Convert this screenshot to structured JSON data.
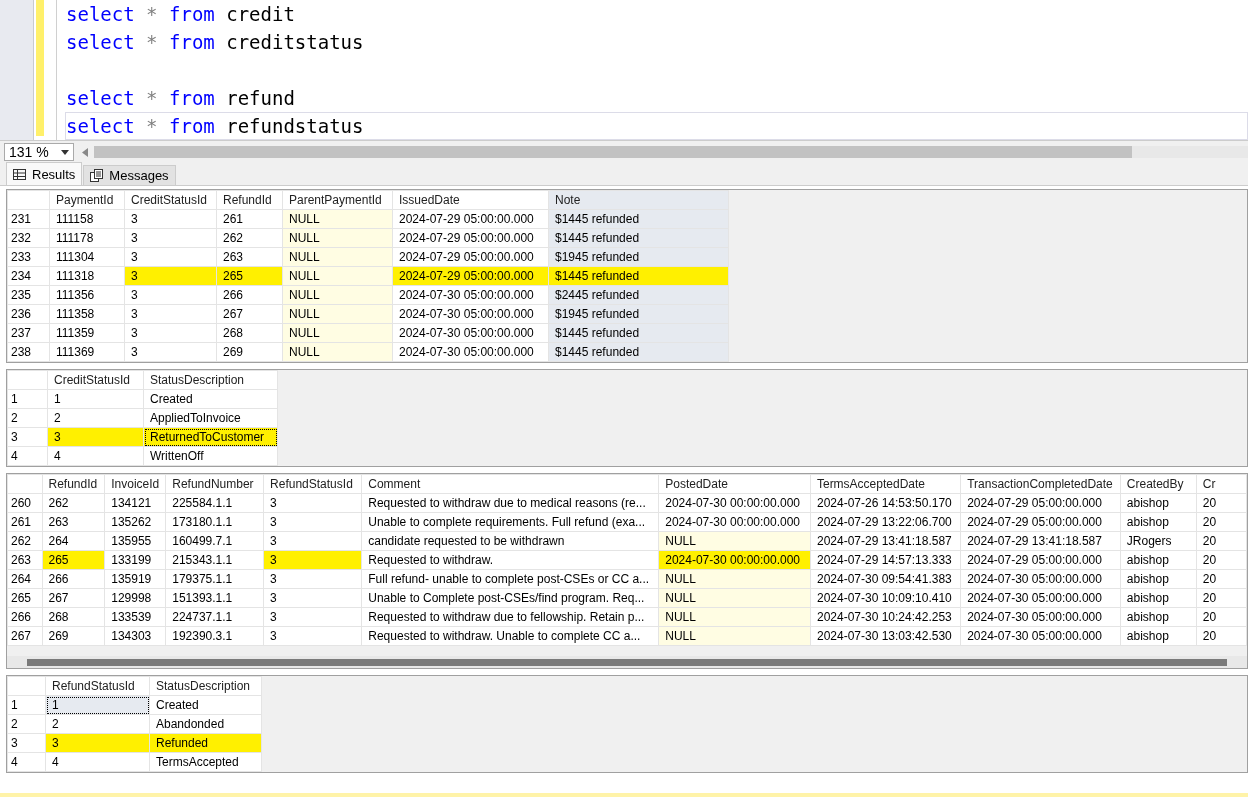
{
  "editor": {
    "lines": [
      {
        "current": false,
        "tokens": [
          {
            "kind": "keyword",
            "text": "select"
          },
          {
            "kind": "operator",
            "text": "*"
          },
          {
            "kind": "keyword",
            "text": "from"
          },
          {
            "kind": "identifier",
            "text": "credit"
          }
        ]
      },
      {
        "current": false,
        "tokens": [
          {
            "kind": "keyword",
            "text": "select"
          },
          {
            "kind": "operator",
            "text": "*"
          },
          {
            "kind": "keyword",
            "text": "from"
          },
          {
            "kind": "identifier",
            "text": "creditstatus"
          }
        ]
      },
      {
        "current": false
      },
      {
        "current": false,
        "tokens": [
          {
            "kind": "keyword",
            "text": "select"
          },
          {
            "kind": "operator",
            "text": "*"
          },
          {
            "kind": "keyword",
            "text": "from"
          },
          {
            "kind": "identifier",
            "text": "refund"
          }
        ]
      },
      {
        "current": true,
        "tokens": [
          {
            "kind": "keyword",
            "text": "select"
          },
          {
            "kind": "operator",
            "text": "*"
          },
          {
            "kind": "keyword",
            "text": "from"
          },
          {
            "kind": "identifier",
            "text": "refundstatus"
          }
        ]
      }
    ]
  },
  "zoom": {
    "value": "131 %"
  },
  "tabs": [
    {
      "label": "Results",
      "selected": true
    },
    {
      "label": "Messages",
      "selected": false
    }
  ],
  "grids": [
    {
      "columns": [
        {
          "label": "PaymentId",
          "selected": false
        },
        {
          "label": "CreditStatusId",
          "selected": false
        },
        {
          "label": "RefundId",
          "selected": false
        },
        {
          "label": "ParentPaymentId",
          "selected": false
        },
        {
          "label": "IssuedDate",
          "selected": false
        },
        {
          "label": "Note",
          "selected": true
        }
      ],
      "rows": [
        {
          "num": "231",
          "cells": [
            {
              "text": "111158",
              "null": false,
              "marked": false,
              "focused": false
            },
            {
              "text": "3",
              "null": false,
              "marked": false,
              "focused": false
            },
            {
              "text": "261",
              "null": false,
              "marked": false,
              "focused": false
            },
            {
              "text": "NULL",
              "null": true,
              "marked": false,
              "focused": false
            },
            {
              "text": "2024-07-29 05:00:00.000",
              "null": false,
              "marked": false,
              "focused": false
            },
            {
              "text": "$1445 refunded",
              "null": false,
              "marked": false,
              "focused": false
            }
          ]
        },
        {
          "num": "232",
          "cells": [
            {
              "text": "111178",
              "null": false,
              "marked": false,
              "focused": false
            },
            {
              "text": "3",
              "null": false,
              "marked": false,
              "focused": false
            },
            {
              "text": "262",
              "null": false,
              "marked": false,
              "focused": false
            },
            {
              "text": "NULL",
              "null": true,
              "marked": false,
              "focused": false
            },
            {
              "text": "2024-07-29 05:00:00.000",
              "null": false,
              "marked": false,
              "focused": false
            },
            {
              "text": "$1445 refunded",
              "null": false,
              "marked": false,
              "focused": false
            }
          ]
        },
        {
          "num": "233",
          "cells": [
            {
              "text": "111304",
              "null": false,
              "marked": false,
              "focused": false
            },
            {
              "text": "3",
              "null": false,
              "marked": false,
              "focused": false
            },
            {
              "text": "263",
              "null": false,
              "marked": false,
              "focused": false
            },
            {
              "text": "NULL",
              "null": true,
              "marked": false,
              "focused": false
            },
            {
              "text": "2024-07-29 05:00:00.000",
              "null": false,
              "marked": false,
              "focused": false
            },
            {
              "text": "$1945 refunded",
              "null": false,
              "marked": false,
              "focused": false
            }
          ]
        },
        {
          "num": "234",
          "cells": [
            {
              "text": "111318",
              "null": false,
              "marked": false,
              "focused": false
            },
            {
              "text": "3",
              "null": false,
              "marked": true,
              "focused": false
            },
            {
              "text": "265",
              "null": false,
              "marked": true,
              "focused": false
            },
            {
              "text": "NULL",
              "null": true,
              "marked": false,
              "focused": false
            },
            {
              "text": "2024-07-29 05:00:00.000",
              "null": false,
              "marked": true,
              "focused": false
            },
            {
              "text": "$1445 refunded",
              "null": false,
              "marked": true,
              "focused": false
            }
          ]
        },
        {
          "num": "235",
          "cells": [
            {
              "text": "111356",
              "null": false,
              "marked": false,
              "focused": false
            },
            {
              "text": "3",
              "null": false,
              "marked": false,
              "focused": false
            },
            {
              "text": "266",
              "null": false,
              "marked": false,
              "focused": false
            },
            {
              "text": "NULL",
              "null": true,
              "marked": false,
              "focused": false
            },
            {
              "text": "2024-07-30 05:00:00.000",
              "null": false,
              "marked": false,
              "focused": false
            },
            {
              "text": "$2445 refunded",
              "null": false,
              "marked": false,
              "focused": false
            }
          ]
        },
        {
          "num": "236",
          "cells": [
            {
              "text": "111358",
              "null": false,
              "marked": false,
              "focused": false
            },
            {
              "text": "3",
              "null": false,
              "marked": false,
              "focused": false
            },
            {
              "text": "267",
              "null": false,
              "marked": false,
              "focused": false
            },
            {
              "text": "NULL",
              "null": true,
              "marked": false,
              "focused": false
            },
            {
              "text": "2024-07-30 05:00:00.000",
              "null": false,
              "marked": false,
              "focused": false
            },
            {
              "text": "$1945 refunded",
              "null": false,
              "marked": false,
              "focused": false
            }
          ]
        },
        {
          "num": "237",
          "cells": [
            {
              "text": "111359",
              "null": false,
              "marked": false,
              "focused": false
            },
            {
              "text": "3",
              "null": false,
              "marked": false,
              "focused": false
            },
            {
              "text": "268",
              "null": false,
              "marked": false,
              "focused": false
            },
            {
              "text": "NULL",
              "null": true,
              "marked": false,
              "focused": false
            },
            {
              "text": "2024-07-30 05:00:00.000",
              "null": false,
              "marked": false,
              "focused": false
            },
            {
              "text": "$1445 refunded",
              "null": false,
              "marked": false,
              "focused": false
            }
          ]
        },
        {
          "num": "238",
          "cells": [
            {
              "text": "111369",
              "null": false,
              "marked": false,
              "focused": false
            },
            {
              "text": "3",
              "null": false,
              "marked": false,
              "focused": false
            },
            {
              "text": "269",
              "null": false,
              "marked": false,
              "focused": false
            },
            {
              "text": "NULL",
              "null": true,
              "marked": false,
              "focused": false
            },
            {
              "text": "2024-07-30 05:00:00.000",
              "null": false,
              "marked": false,
              "focused": false
            },
            {
              "text": "$1445 refunded",
              "null": false,
              "marked": false,
              "focused": false
            }
          ]
        }
      ]
    },
    {
      "columns": [
        {
          "label": "CreditStatusId",
          "selected": false
        },
        {
          "label": "StatusDescription",
          "selected": false
        }
      ],
      "rows": [
        {
          "num": "1",
          "cells": [
            {
              "text": "1",
              "null": false,
              "marked": false,
              "focused": false
            },
            {
              "text": "Created",
              "null": false,
              "marked": false,
              "focused": false
            }
          ]
        },
        {
          "num": "2",
          "cells": [
            {
              "text": "2",
              "null": false,
              "marked": false,
              "focused": false
            },
            {
              "text": "AppliedToInvoice",
              "null": false,
              "marked": false,
              "focused": false
            }
          ]
        },
        {
          "num": "3",
          "cells": [
            {
              "text": "3",
              "null": false,
              "marked": true,
              "focused": false
            },
            {
              "text": "ReturnedToCustomer",
              "null": false,
              "marked": true,
              "focused": true
            }
          ]
        },
        {
          "num": "4",
          "cells": [
            {
              "text": "4",
              "null": false,
              "marked": false,
              "focused": false
            },
            {
              "text": "WrittenOff",
              "null": false,
              "marked": false,
              "focused": false
            }
          ]
        }
      ]
    },
    {
      "columns": [
        {
          "label": "RefundId",
          "selected": false
        },
        {
          "label": "InvoiceId",
          "selected": false
        },
        {
          "label": "RefundNumber",
          "selected": false
        },
        {
          "label": "RefundStatusId",
          "selected": false
        },
        {
          "label": "Comment",
          "selected": false
        },
        {
          "label": "PostedDate",
          "selected": false
        },
        {
          "label": "TermsAcceptedDate",
          "selected": false
        },
        {
          "label": "TransactionCompletedDate",
          "selected": false
        },
        {
          "label": "CreatedBy",
          "selected": false
        },
        {
          "label": "Cr",
          "selected": false
        }
      ],
      "rows": [
        {
          "num": "260",
          "cells": [
            {
              "text": "262",
              "null": false,
              "marked": false,
              "focused": false
            },
            {
              "text": "134121",
              "null": false,
              "marked": false,
              "focused": false
            },
            {
              "text": "225584.1.1",
              "null": false,
              "marked": false,
              "focused": false
            },
            {
              "text": "3",
              "null": false,
              "marked": false,
              "focused": false
            },
            {
              "text": "Requested to withdraw due to medical reasons (re...",
              "null": false,
              "marked": false,
              "focused": false
            },
            {
              "text": "2024-07-30 00:00:00.000",
              "null": false,
              "marked": false,
              "focused": false
            },
            {
              "text": "2024-07-26 14:53:50.170",
              "null": false,
              "marked": false,
              "focused": false
            },
            {
              "text": "2024-07-29 05:00:00.000",
              "null": false,
              "marked": false,
              "focused": false
            },
            {
              "text": "abishop",
              "null": false,
              "marked": false,
              "focused": false
            },
            {
              "text": "20",
              "null": false,
              "marked": false,
              "focused": false
            }
          ]
        },
        {
          "num": "261",
          "cells": [
            {
              "text": "263",
              "null": false,
              "marked": false,
              "focused": false
            },
            {
              "text": "135262",
              "null": false,
              "marked": false,
              "focused": false
            },
            {
              "text": "173180.1.1",
              "null": false,
              "marked": false,
              "focused": false
            },
            {
              "text": "3",
              "null": false,
              "marked": false,
              "focused": false
            },
            {
              "text": "Unable to complete requirements. Full refund (exa...",
              "null": false,
              "marked": false,
              "focused": false
            },
            {
              "text": "2024-07-30 00:00:00.000",
              "null": false,
              "marked": false,
              "focused": false
            },
            {
              "text": "2024-07-29 13:22:06.700",
              "null": false,
              "marked": false,
              "focused": false
            },
            {
              "text": "2024-07-29 05:00:00.000",
              "null": false,
              "marked": false,
              "focused": false
            },
            {
              "text": "abishop",
              "null": false,
              "marked": false,
              "focused": false
            },
            {
              "text": "20",
              "null": false,
              "marked": false,
              "focused": false
            }
          ]
        },
        {
          "num": "262",
          "cells": [
            {
              "text": "264",
              "null": false,
              "marked": false,
              "focused": false
            },
            {
              "text": "135955",
              "null": false,
              "marked": false,
              "focused": false
            },
            {
              "text": "160499.7.1",
              "null": false,
              "marked": false,
              "focused": false
            },
            {
              "text": "3",
              "null": false,
              "marked": false,
              "focused": false
            },
            {
              "text": "candidate requested to be withdrawn",
              "null": false,
              "marked": false,
              "focused": false
            },
            {
              "text": "NULL",
              "null": true,
              "marked": false,
              "focused": false
            },
            {
              "text": "2024-07-29 13:41:18.587",
              "null": false,
              "marked": false,
              "focused": false
            },
            {
              "text": "2024-07-29 13:41:18.587",
              "null": false,
              "marked": false,
              "focused": false
            },
            {
              "text": "JRogers",
              "null": false,
              "marked": false,
              "focused": false
            },
            {
              "text": "20",
              "null": false,
              "marked": false,
              "focused": false
            }
          ]
        },
        {
          "num": "263",
          "cells": [
            {
              "text": "265",
              "null": false,
              "marked": true,
              "focused": false
            },
            {
              "text": "133199",
              "null": false,
              "marked": false,
              "focused": false
            },
            {
              "text": "215343.1.1",
              "null": false,
              "marked": false,
              "focused": false
            },
            {
              "text": "3",
              "null": false,
              "marked": true,
              "focused": false
            },
            {
              "text": "Requested to withdraw.",
              "null": false,
              "marked": false,
              "focused": false
            },
            {
              "text": "2024-07-30 00:00:00.000",
              "null": false,
              "marked": true,
              "focused": false
            },
            {
              "text": "2024-07-29 14:57:13.333",
              "null": false,
              "marked": false,
              "focused": false
            },
            {
              "text": "2024-07-29 05:00:00.000",
              "null": false,
              "marked": false,
              "focused": false
            },
            {
              "text": "abishop",
              "null": false,
              "marked": false,
              "focused": false
            },
            {
              "text": "20",
              "null": false,
              "marked": false,
              "focused": false
            }
          ]
        },
        {
          "num": "264",
          "cells": [
            {
              "text": "266",
              "null": false,
              "marked": false,
              "focused": false
            },
            {
              "text": "135919",
              "null": false,
              "marked": false,
              "focused": false
            },
            {
              "text": "179375.1.1",
              "null": false,
              "marked": false,
              "focused": false
            },
            {
              "text": "3",
              "null": false,
              "marked": false,
              "focused": false
            },
            {
              "text": "Full refund- unable to complete post-CSEs or CC a...",
              "null": false,
              "marked": false,
              "focused": false
            },
            {
              "text": "NULL",
              "null": true,
              "marked": false,
              "focused": false
            },
            {
              "text": "2024-07-30 09:54:41.383",
              "null": false,
              "marked": false,
              "focused": false
            },
            {
              "text": "2024-07-30 05:00:00.000",
              "null": false,
              "marked": false,
              "focused": false
            },
            {
              "text": "abishop",
              "null": false,
              "marked": false,
              "focused": false
            },
            {
              "text": "20",
              "null": false,
              "marked": false,
              "focused": false
            }
          ]
        },
        {
          "num": "265",
          "cells": [
            {
              "text": "267",
              "null": false,
              "marked": false,
              "focused": false
            },
            {
              "text": "129998",
              "null": false,
              "marked": false,
              "focused": false
            },
            {
              "text": "151393.1.1",
              "null": false,
              "marked": false,
              "focused": false
            },
            {
              "text": "3",
              "null": false,
              "marked": false,
              "focused": false
            },
            {
              "text": "Unable to Complete post-CSEs/find program. Req...",
              "null": false,
              "marked": false,
              "focused": false
            },
            {
              "text": "NULL",
              "null": true,
              "marked": false,
              "focused": false
            },
            {
              "text": "2024-07-30 10:09:10.410",
              "null": false,
              "marked": false,
              "focused": false
            },
            {
              "text": "2024-07-30 05:00:00.000",
              "null": false,
              "marked": false,
              "focused": false
            },
            {
              "text": "abishop",
              "null": false,
              "marked": false,
              "focused": false
            },
            {
              "text": "20",
              "null": false,
              "marked": false,
              "focused": false
            }
          ]
        },
        {
          "num": "266",
          "cells": [
            {
              "text": "268",
              "null": false,
              "marked": false,
              "focused": false
            },
            {
              "text": "133539",
              "null": false,
              "marked": false,
              "focused": false
            },
            {
              "text": "224737.1.1",
              "null": false,
              "marked": false,
              "focused": false
            },
            {
              "text": "3",
              "null": false,
              "marked": false,
              "focused": false
            },
            {
              "text": "Requested to withdraw due to fellowship.  Retain p...",
              "null": false,
              "marked": false,
              "focused": false
            },
            {
              "text": "NULL",
              "null": true,
              "marked": false,
              "focused": false
            },
            {
              "text": "2024-07-30 10:24:42.253",
              "null": false,
              "marked": false,
              "focused": false
            },
            {
              "text": "2024-07-30 05:00:00.000",
              "null": false,
              "marked": false,
              "focused": false
            },
            {
              "text": "abishop",
              "null": false,
              "marked": false,
              "focused": false
            },
            {
              "text": "20",
              "null": false,
              "marked": false,
              "focused": false
            }
          ]
        },
        {
          "num": "267",
          "cells": [
            {
              "text": "269",
              "null": false,
              "marked": false,
              "focused": false
            },
            {
              "text": "134303",
              "null": false,
              "marked": false,
              "focused": false
            },
            {
              "text": "192390.3.1",
              "null": false,
              "marked": false,
              "focused": false
            },
            {
              "text": "3",
              "null": false,
              "marked": false,
              "focused": false
            },
            {
              "text": "Requested to withdraw.  Unable to complete CC a...",
              "null": false,
              "marked": false,
              "focused": false
            },
            {
              "text": "NULL",
              "null": true,
              "marked": false,
              "focused": false
            },
            {
              "text": "2024-07-30 13:03:42.530",
              "null": false,
              "marked": false,
              "focused": false
            },
            {
              "text": "2024-07-30 05:00:00.000",
              "null": false,
              "marked": false,
              "focused": false
            },
            {
              "text": "abishop",
              "null": false,
              "marked": false,
              "focused": false
            },
            {
              "text": "20",
              "null": false,
              "marked": false,
              "focused": false
            }
          ]
        }
      ]
    },
    {
      "columns": [
        {
          "label": "RefundStatusId",
          "selected": false
        },
        {
          "label": "StatusDescription",
          "selected": false
        }
      ],
      "rows": [
        {
          "num": "1",
          "cells": [
            {
              "text": "1",
              "null": false,
              "marked": false,
              "focused": true
            },
            {
              "text": "Created",
              "null": false,
              "marked": false,
              "focused": false
            }
          ]
        },
        {
          "num": "2",
          "cells": [
            {
              "text": "2",
              "null": false,
              "marked": false,
              "focused": false
            },
            {
              "text": "Abandonded",
              "null": false,
              "marked": false,
              "focused": false
            }
          ]
        },
        {
          "num": "3",
          "cells": [
            {
              "text": "3",
              "null": false,
              "marked": true,
              "focused": false
            },
            {
              "text": "Refunded",
              "null": false,
              "marked": true,
              "focused": false
            }
          ]
        },
        {
          "num": "4",
          "cells": [
            {
              "text": "4",
              "null": false,
              "marked": false,
              "focused": false
            },
            {
              "text": "TermsAccepted",
              "null": false,
              "marked": false,
              "focused": false
            }
          ]
        }
      ]
    }
  ]
}
